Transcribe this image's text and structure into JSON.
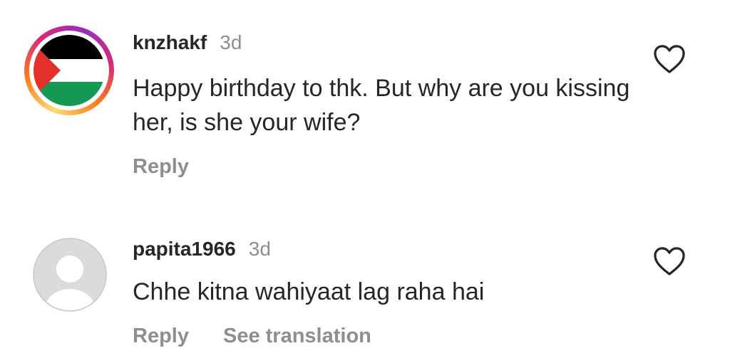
{
  "comments": [
    {
      "username": "knzhakf",
      "time": "3d",
      "text": "Happy birthday to thk. But why are you kissing her, is she your wife?",
      "reply_label": "Reply",
      "avatar_icon": "palestine-flag-avatar",
      "like_icon": "heart-outline-icon"
    },
    {
      "username": "papita1966",
      "time": "3d",
      "text": "Chhe kitna wahiyaat lag raha hai",
      "reply_label": "Reply",
      "translation_label": "See translation",
      "avatar_icon": "default-avatar",
      "like_icon": "heart-outline-icon"
    }
  ],
  "colors": {
    "text": "#262626",
    "secondary": "#8e8e8e",
    "flag_black": "#000000",
    "flag_green": "#149954",
    "flag_red": "#e4312b",
    "default_avatar_bg": "#dbdbdb"
  }
}
